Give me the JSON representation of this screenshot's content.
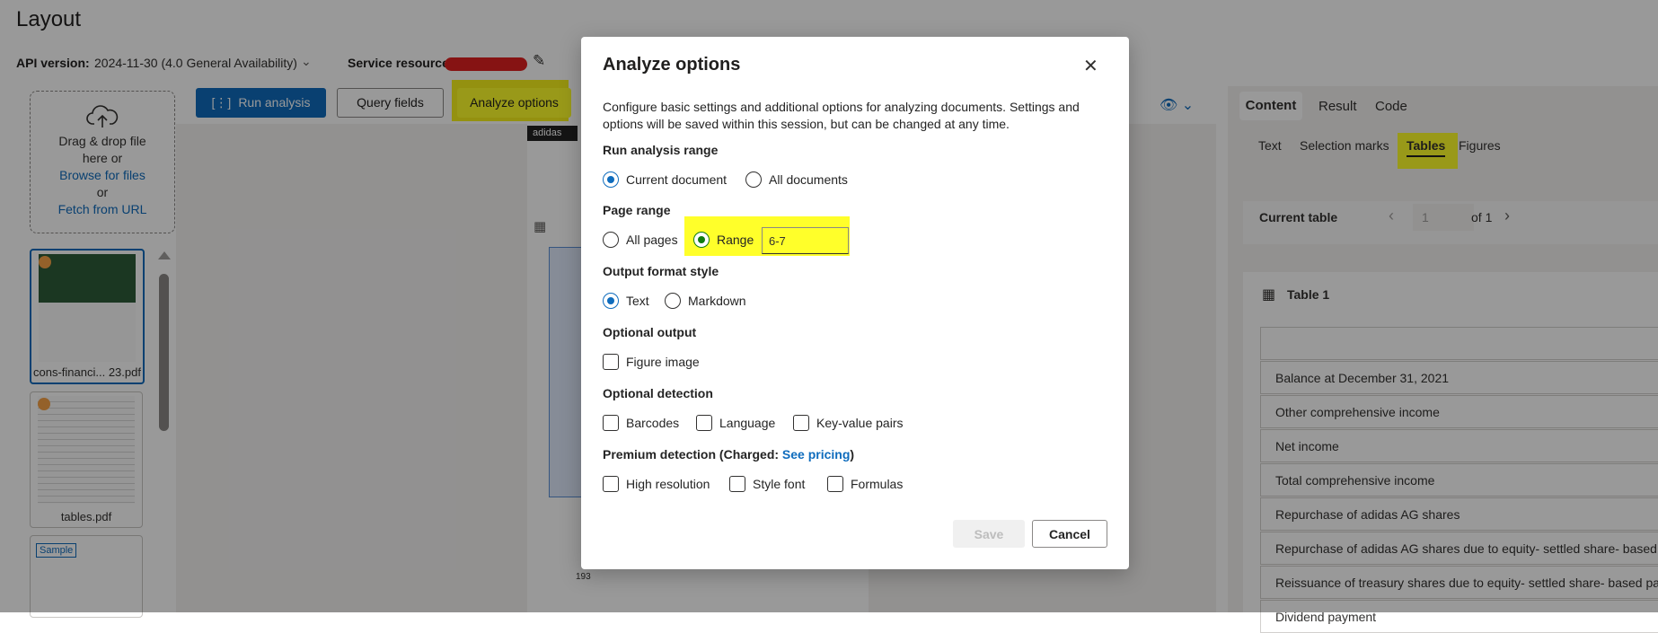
{
  "page": {
    "title": "Layout",
    "api_label": "API version:",
    "api_value": "2024-11-30 (4.0 General Availability)",
    "service_label": "Service resource"
  },
  "left_panel": {
    "drop_line1": "Drag & drop file",
    "drop_line2": "here or",
    "browse": "Browse for files",
    "or": "or",
    "fetch": "Fetch from URL",
    "files": [
      {
        "caption": "cons-financi... 23.pdf"
      },
      {
        "caption": "tables.pdf"
      },
      {
        "caption": "Sample"
      }
    ]
  },
  "toolbar": {
    "run": "Run analysis",
    "query": "Query fields",
    "analyze": "Analyze options"
  },
  "document": {
    "brand": "adidas",
    "page_number": "193"
  },
  "right_panel": {
    "tabs": [
      "Content",
      "Result",
      "Code"
    ],
    "subtabs": [
      "Text",
      "Selection marks",
      "Tables",
      "Figures"
    ],
    "current_table_label": "Current table",
    "page_value": "1",
    "of_label": "of 1",
    "table_title": "Table 1",
    "rows": [
      "",
      "Balance at December 31, 2021",
      "Other comprehensive income",
      "Net income",
      "Total comprehensive income",
      "Repurchase of adidas AG shares",
      "Repurchase of adidas AG shares due to equity- settled share- based o",
      "Reissuance of treasury shares due to equity- settled share- based pay",
      "Dividend payment"
    ]
  },
  "dialog": {
    "title": "Analyze options",
    "description": "Configure basic settings and additional options for analyzing documents. Settings and options will be saved within this session, but can be changed at any time.",
    "run_range": {
      "label": "Run analysis range",
      "options": [
        "Current document",
        "All documents"
      ],
      "selected": "Current document"
    },
    "page_range": {
      "label": "Page range",
      "options": [
        "All pages",
        "Range"
      ],
      "selected": "Range",
      "range_value": "6-7"
    },
    "output_format": {
      "label": "Output format style",
      "options": [
        "Text",
        "Markdown"
      ],
      "selected": "Text"
    },
    "optional_output": {
      "label": "Optional output",
      "options": [
        "Figure image"
      ]
    },
    "optional_detection": {
      "label": "Optional detection",
      "options": [
        "Barcodes",
        "Language",
        "Key-value pairs"
      ]
    },
    "premium_detection": {
      "label_prefix": "Premium detection (Charged: ",
      "link": "See pricing",
      "label_suffix": ")",
      "options": [
        "High resolution",
        "Style font",
        "Formulas"
      ]
    },
    "save": "Save",
    "cancel": "Cancel"
  },
  "colors": {
    "accent": "#0f6cbd",
    "highlight": "#ffff2a",
    "redaction": "#e02020"
  }
}
